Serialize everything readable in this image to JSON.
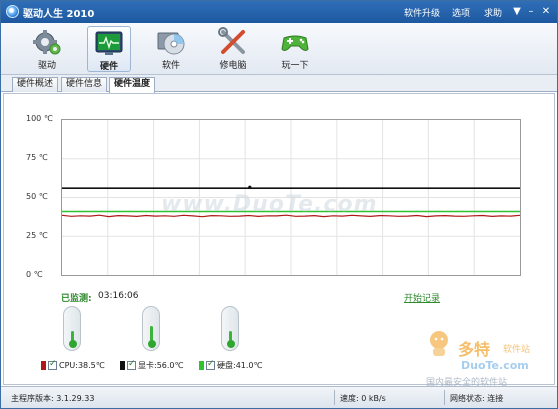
{
  "titlebar": {
    "title": "驱动人生 2010",
    "menu": [
      "软件升级",
      "选项",
      "求助"
    ]
  },
  "toolbar": {
    "items": [
      {
        "label": "驱动",
        "icon": "gear-icon"
      },
      {
        "label": "硬件",
        "icon": "hardware-monitor-icon"
      },
      {
        "label": "软件",
        "icon": "software-disc-icon"
      },
      {
        "label": "修电脑",
        "icon": "tools-icon"
      },
      {
        "label": "玩一下",
        "icon": "gamepad-icon"
      }
    ],
    "active": "硬件"
  },
  "tabs": [
    "硬件概述",
    "硬件信息",
    "硬件温度"
  ],
  "active_tab": "硬件温度",
  "chart_data": {
    "type": "line",
    "ylabels": [
      "100 ℃",
      "75 ℃",
      "50 ℃",
      "25 ℃",
      "0 ℃"
    ],
    "ylim": [
      0,
      100
    ],
    "grid": true,
    "xcount": 50,
    "series": [
      {
        "name": "CPU",
        "color": "#b01818",
        "values": [
          38.5,
          37.9,
          38.2,
          38.0,
          38.6,
          37.7,
          38.3,
          38.1,
          37.8,
          38.4,
          38.0,
          38.2,
          37.9,
          38.5,
          38.1,
          37.6,
          38.3,
          38.2,
          37.9,
          38.0,
          38.4,
          37.8,
          38.2,
          38.1,
          38.6,
          37.9,
          38.0,
          38.3,
          37.7,
          38.2,
          38.0,
          38.5,
          38.1,
          37.8,
          38.3,
          38.2,
          37.9,
          38.0,
          38.4,
          37.7,
          38.1,
          38.3,
          38.0,
          37.9,
          38.2,
          38.4,
          37.8,
          38.1,
          38.0,
          38.5
        ]
      },
      {
        "name": "显卡",
        "color": "#111111",
        "values": [
          56,
          56,
          56,
          56,
          56,
          56,
          56,
          56,
          56,
          56,
          56,
          56,
          56,
          56,
          56,
          56,
          56,
          56,
          56,
          56,
          56,
          56,
          56,
          56,
          56,
          56,
          56,
          56,
          56,
          56,
          56,
          56,
          56,
          56,
          56,
          56,
          56,
          56,
          56,
          56,
          56,
          56,
          56,
          56,
          56,
          56,
          56,
          56,
          56,
          56
        ]
      },
      {
        "name": "硬盘",
        "color": "#2fc12f",
        "values": [
          41,
          41,
          41,
          41,
          41,
          41,
          41,
          41,
          41,
          41,
          41,
          41,
          41,
          41,
          41,
          41,
          41,
          41,
          41,
          41,
          41,
          41,
          41,
          41,
          41,
          41,
          41,
          41,
          41,
          41,
          41,
          41,
          41,
          41,
          41,
          41,
          41,
          41,
          41,
          41,
          41,
          41,
          41,
          41,
          41,
          41,
          41,
          41,
          41,
          41
        ]
      }
    ]
  },
  "monitor": {
    "label": "已监测:",
    "time": "03:16:06",
    "start_record": "开始记录"
  },
  "thermometers": [
    {
      "level": 0.385,
      "color": "#3cb43c"
    },
    {
      "level": 0.56,
      "color": "#3cb43c"
    },
    {
      "level": 0.41,
      "color": "#3cb43c"
    }
  ],
  "legend": [
    {
      "text": "CPU:38.5℃",
      "color": "#b01818"
    },
    {
      "text": "显卡:56.0℃",
      "color": "#111111"
    },
    {
      "text": "硬盘:41.0℃",
      "color": "#2fc12f"
    }
  ],
  "watermark": {
    "center": "www.DuoTe.com",
    "brand": "多特",
    "brand_sub": "软件站",
    "site": "DuoTe.com",
    "tagline": "国内最安全的软件站"
  },
  "status": {
    "version": "主程序版本: 3.1.29.33",
    "speed": "速度:   0 kB/s",
    "network": "网络状态: 连接"
  }
}
